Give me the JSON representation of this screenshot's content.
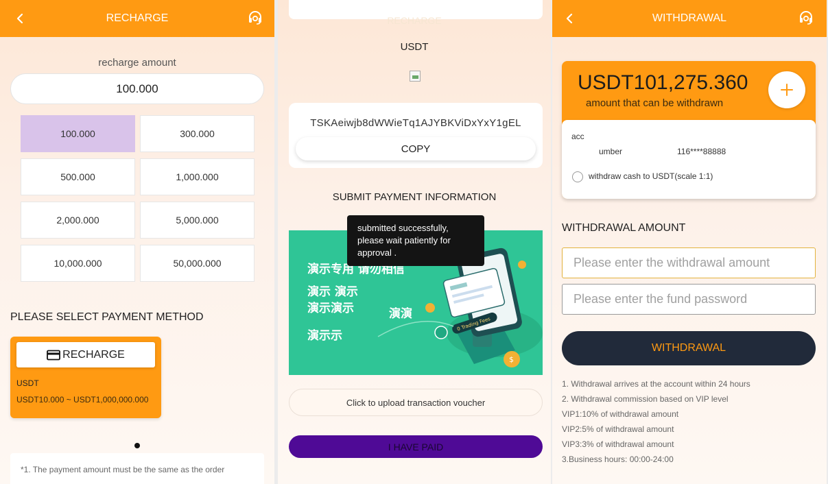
{
  "colors": {
    "accent": "#ff9a12",
    "selected": "#d9c3ea",
    "purple_btn": "#4f0a96",
    "dark_btn": "#212a3a"
  },
  "recharge": {
    "header_title": "RECHARGE",
    "amount_label": "recharge amount",
    "amount_value": "100.000",
    "amounts": [
      "100.000",
      "300.000",
      "500.000",
      "1,000.000",
      "2,000.000",
      "5,000.000",
      "10,000.000",
      "50,000.000"
    ],
    "selected_amount": "100.000",
    "payment_method_title": "PLEASE SELECT PAYMENT METHOD",
    "method": {
      "button_label": "RECHARGE",
      "currency": "USDT",
      "range": "USDT10.000 ~ USDT1,000,000.000"
    },
    "note": "*1. The payment amount must be the same as the order"
  },
  "payment": {
    "faded_label": "RECHARGE",
    "currency": "USDT",
    "address": "TSKAeiwjb8dWWieTq1AJYBKViDxYxY1gEL",
    "copy_label": "COPY",
    "submit_title": "SUBMIT PAYMENT INFORMATION",
    "banner_texts": [
      "演示专用 请勿相信",
      "演示 演示",
      "演示演示",
      "演演",
      "演示示"
    ],
    "toast": "submitted successfully, please wait patiently for approval .",
    "upload_label": "Click to upload transaction voucher",
    "paid_label": "I HAVE PAID"
  },
  "withdrawal": {
    "header_title": "WITHDRAWAL",
    "balance": "USDT101,275.360",
    "balance_sub": "amount that can be withdrawn",
    "account_label": "acc",
    "number_label": "umber",
    "number_value": "116****88888",
    "option_label": "withdraw cash to USDT(scale 1:1)",
    "amount_title": "WITHDRAWAL AMOUNT",
    "amount_placeholder": "Please enter the withdrawal amount",
    "password_placeholder": "Please enter the fund password",
    "button_label": "WITHDRAWAL",
    "rules": [
      "1. Withdrawal arrives at the account within 24 hours",
      "2. Withdrawal commission based on VIP level",
      "VIP1:10% of withdrawal amount",
      "VIP2:5% of withdrawal amount",
      "VIP3:3% of withdrawal amount",
      "3.Business hours: 00:00-24:00"
    ]
  }
}
